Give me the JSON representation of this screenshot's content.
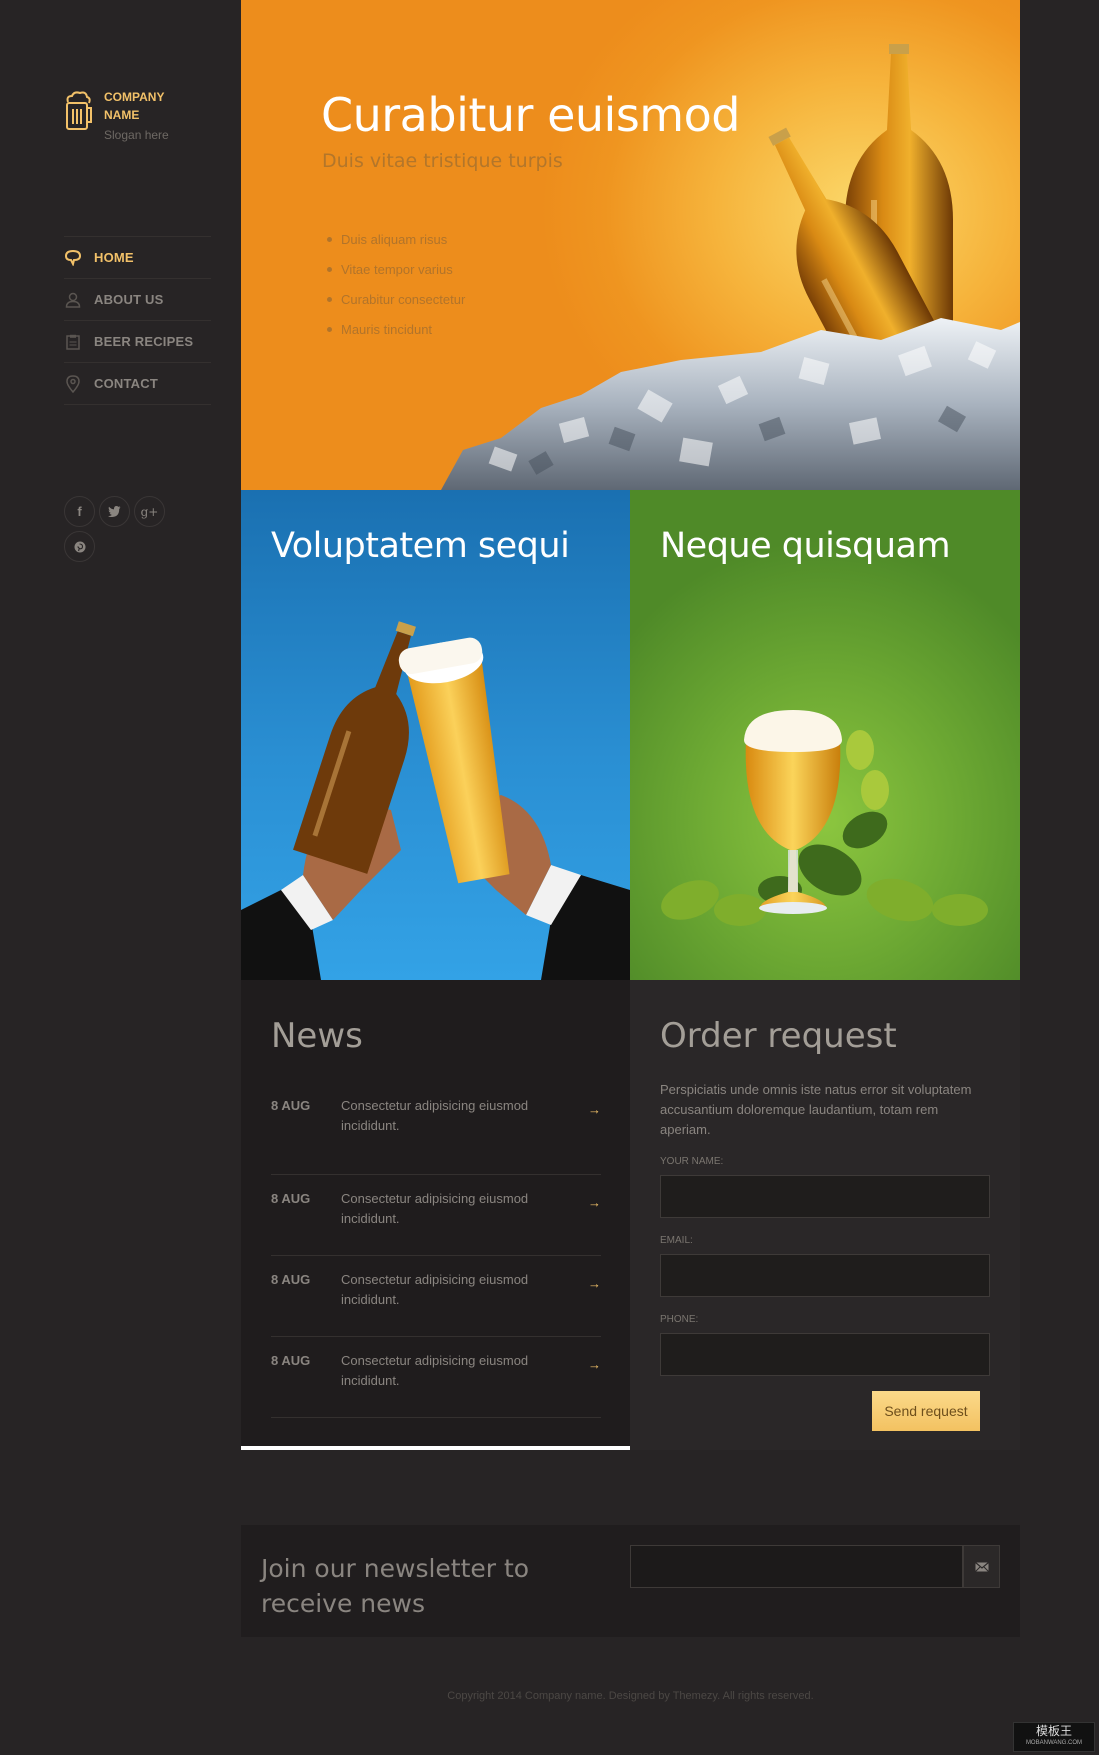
{
  "brand": {
    "name": "COMPANY NAME",
    "slogan": "Slogan here"
  },
  "nav": {
    "items": [
      {
        "label": "HOME",
        "icon": "chat-bubble-icon",
        "active": true
      },
      {
        "label": "ABOUT US",
        "icon": "user-icon",
        "active": false
      },
      {
        "label": "BEER RECIPES",
        "icon": "clipboard-icon",
        "active": false
      },
      {
        "label": "CONTACT",
        "icon": "map-pin-icon",
        "active": false
      }
    ]
  },
  "social": {
    "facebook": "f",
    "twitter": "twitter-icon",
    "google_plus": "g+",
    "pinterest": "pinterest-icon"
  },
  "hero": {
    "title": "Curabitur euismod",
    "subtitle": "Duis vitae tristique turpis",
    "list": [
      "Duis aliquam risus",
      "Vitae tempor varius",
      "Curabitur consectetur",
      "Mauris tincidunt"
    ]
  },
  "tiles": {
    "left_title": "Voluptatem sequi",
    "right_title": "Neque quisquam"
  },
  "news": {
    "title": "News",
    "items": [
      {
        "date": "8 AUG",
        "text": "Consectetur adipisicing eiusmod incididunt.",
        "arrow": "→"
      },
      {
        "date": "8 AUG",
        "text": "Consectetur adipisicing eiusmod incididunt.",
        "arrow": "→"
      },
      {
        "date": "8 AUG",
        "text": "Consectetur adipisicing eiusmod incididunt.",
        "arrow": "→"
      },
      {
        "date": "8 AUG",
        "text": "Consectetur adipisicing eiusmod incididunt.",
        "arrow": "→"
      }
    ]
  },
  "order": {
    "title": "Order request",
    "description": "Perspiciatis unde omnis iste natus error sit voluptatem accusantium doloremque laudantium, totam rem aperiam.",
    "name_label": "YOUR NAME:",
    "name_value": "",
    "email_label": "EMAIL:",
    "email_value": "",
    "phone_label": "PHONE:",
    "phone_value": "",
    "submit_label": "Send request"
  },
  "newsletter": {
    "text": "Join our newsletter to receive news",
    "input_value": ""
  },
  "footer": {
    "copyright": "Copyright 2014 Company name. Designed by Themezy. All rights reserved."
  },
  "watermark": {
    "title": "模板王",
    "site": "MOBANWANG.COM"
  },
  "colors": {
    "accent": "#f2c169",
    "background": "#272425",
    "hero_orange": "#ef9520",
    "tile_blue": "#2a8fd3",
    "tile_green": "#6aa632"
  }
}
